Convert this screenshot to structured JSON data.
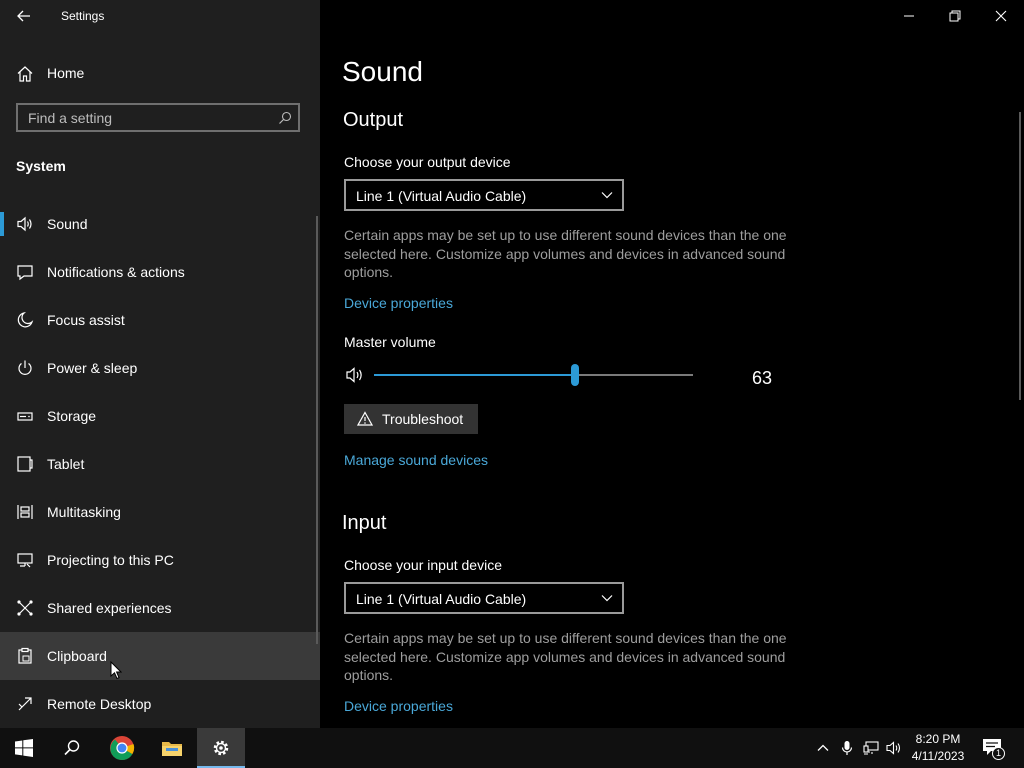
{
  "window": {
    "title": "Settings",
    "back_icon": "back-arrow-icon",
    "minimize_icon": "minimize-icon",
    "restore_icon": "restore-icon",
    "close_icon": "close-icon"
  },
  "sidebar": {
    "home_label": "Home",
    "search_placeholder": "Find a setting",
    "section": "System",
    "items": [
      {
        "label": "Sound",
        "icon": "speaker-icon",
        "active": true
      },
      {
        "label": "Notifications & actions",
        "icon": "notification-icon"
      },
      {
        "label": "Focus assist",
        "icon": "moon-icon"
      },
      {
        "label": "Power & sleep",
        "icon": "power-icon"
      },
      {
        "label": "Storage",
        "icon": "storage-icon"
      },
      {
        "label": "Tablet",
        "icon": "tablet-icon"
      },
      {
        "label": "Multitasking",
        "icon": "multitasking-icon"
      },
      {
        "label": "Projecting to this PC",
        "icon": "projecting-icon"
      },
      {
        "label": "Shared experiences",
        "icon": "shared-experiences-icon"
      },
      {
        "label": "Clipboard",
        "icon": "clipboard-icon",
        "hovered": true
      },
      {
        "label": "Remote Desktop",
        "icon": "remote-desktop-icon"
      }
    ]
  },
  "main": {
    "title": "Sound",
    "output": {
      "heading": "Output",
      "device_label": "Choose your output device",
      "device_value": "Line 1 (Virtual Audio Cable)",
      "description": "Certain apps may be set up to use different sound devices than the one selected here. Customize app volumes and devices in advanced sound options.",
      "device_properties": "Device properties",
      "master_volume_label": "Master volume",
      "volume_value": "63",
      "troubleshoot": "Troubleshoot",
      "manage_devices": "Manage sound devices"
    },
    "input": {
      "heading": "Input",
      "device_label": "Choose your input device",
      "device_value": "Line 1 (Virtual Audio Cable)",
      "description": "Certain apps may be set up to use different sound devices than the one selected here. Customize app volumes and devices in advanced sound options.",
      "device_properties": "Device properties"
    }
  },
  "taskbar": {
    "time": "8:20 PM",
    "date": "4/11/2023",
    "notification_count": "1",
    "colors": {
      "accent": "#2c9ad6",
      "link": "#4aa8d8",
      "chrome_red": "#db4437",
      "chrome_yellow": "#f4b400",
      "chrome_green": "#0f9d58",
      "chrome_blue": "#4285f4"
    }
  }
}
